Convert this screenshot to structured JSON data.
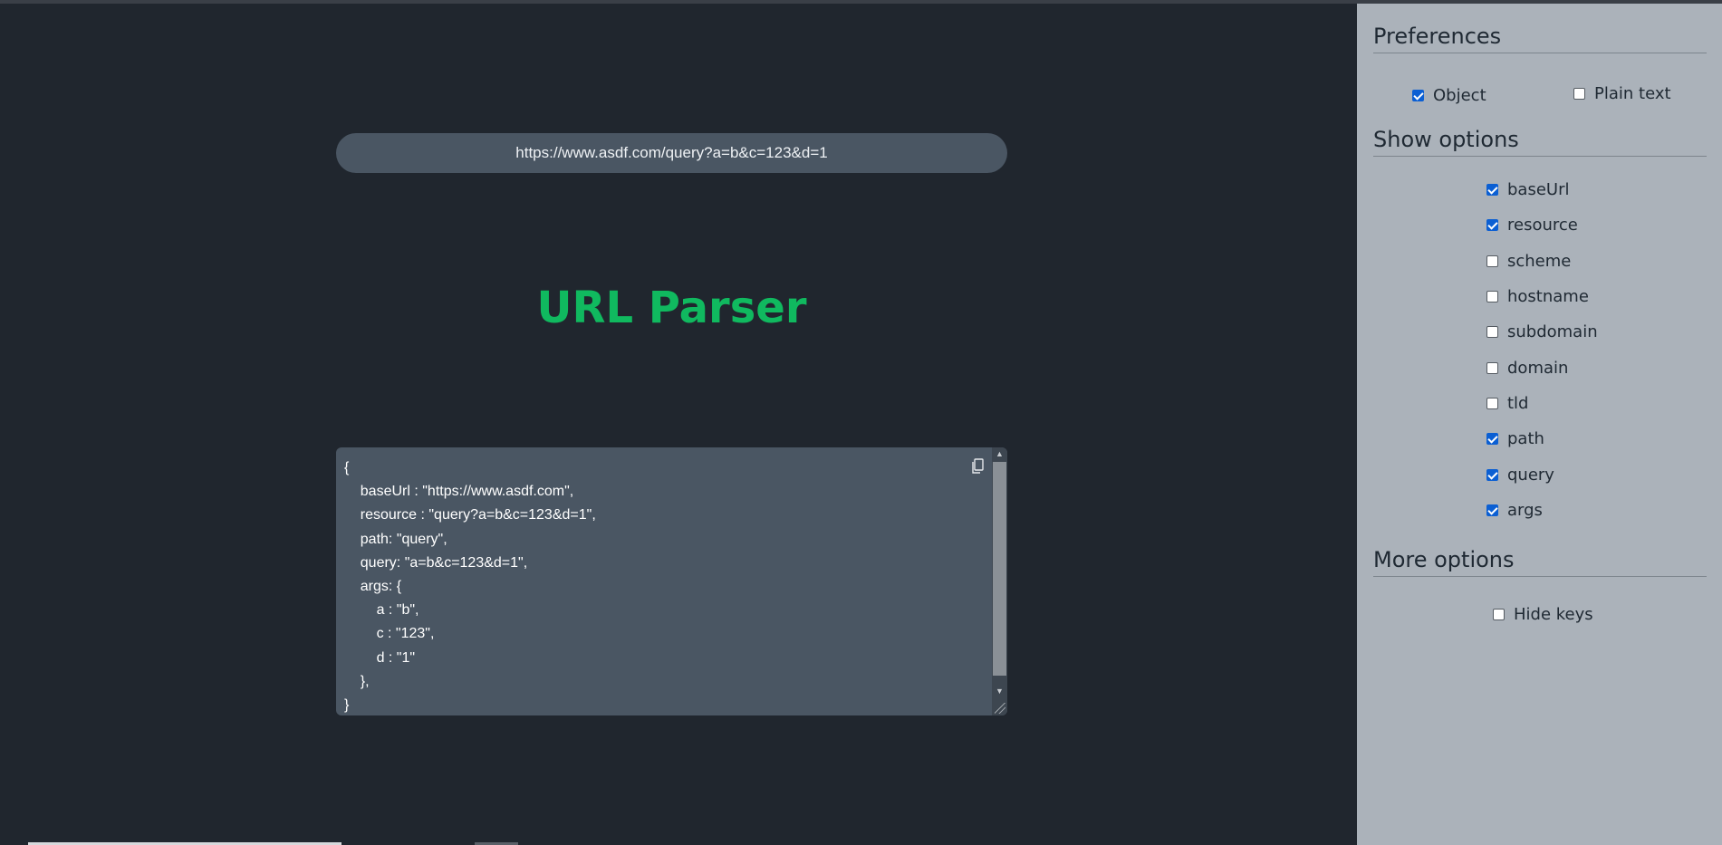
{
  "input": {
    "value": "https://www.asdf.com/query?a=b&c=123&d=1"
  },
  "title": "URL Parser",
  "output": {
    "text": "{\n    baseUrl : \"https://www.asdf.com\",\n    resource : \"query?a=b&c=123&d=1\",\n    path: \"query\",\n    query: \"a=b&c=123&d=1\",\n    args: {\n        a : \"b\",\n        c : \"123\",\n        d : \"1\"\n    },\n}",
    "copy_icon": "copy-icon"
  },
  "sidebar": {
    "preferences": {
      "heading": "Preferences",
      "options": [
        {
          "label": "Object",
          "checked": true
        },
        {
          "label": "Plain text",
          "checked": false
        }
      ]
    },
    "show_options": {
      "heading": "Show options",
      "options": [
        {
          "label": "baseUrl",
          "checked": true
        },
        {
          "label": "resource",
          "checked": true
        },
        {
          "label": "scheme",
          "checked": false
        },
        {
          "label": "hostname",
          "checked": false
        },
        {
          "label": "subdomain",
          "checked": false
        },
        {
          "label": "domain",
          "checked": false
        },
        {
          "label": "tld",
          "checked": false
        },
        {
          "label": "path",
          "checked": true
        },
        {
          "label": "query",
          "checked": true
        },
        {
          "label": "args",
          "checked": true
        }
      ]
    },
    "more_options": {
      "heading": "More options",
      "options": [
        {
          "label": "Hide keys",
          "checked": false
        }
      ]
    }
  },
  "colors": {
    "background": "#20262e",
    "title": "#10b95f",
    "panel": "#4a5663",
    "sidebar": "#abb2ba",
    "checkbox_checked": "#0b5fd3"
  }
}
